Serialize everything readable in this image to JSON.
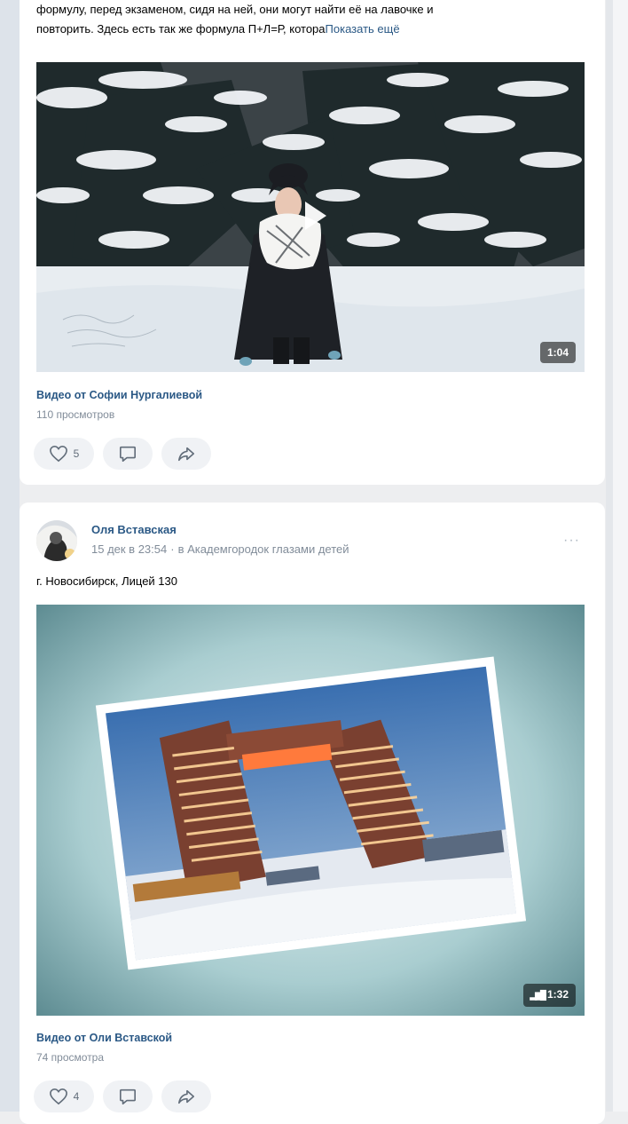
{
  "post1": {
    "text_line1": "формулу, перед экзаменом, сидя на ней, они могут найти её на лавочке и",
    "text_line2": "повторить. Здесь есть так же формула П+Л=Р, котора",
    "show_more": "Показать ещё",
    "video": {
      "duration": "1:04",
      "title": "Видео от Софии Нургалиевой",
      "views": "110 просмотров"
    },
    "likes": "5"
  },
  "post2": {
    "author": "Оля Вставская",
    "time": "15 дек в 23:54",
    "separator": "·",
    "community": "в Академгородок глазами детей",
    "more": "···",
    "text": "г. Новосибирск, Лицей 130",
    "video": {
      "duration": "1:32",
      "title": "Видео от Оли Вставской",
      "views": "74 просмотра"
    },
    "likes": "4"
  },
  "icons": {
    "like": "heart-icon",
    "comment": "comment-icon",
    "share": "share-arrow-icon",
    "play": "play-icon",
    "sound_bars": "audio-bars-icon"
  },
  "colors": {
    "link": "#2a5885",
    "muted": "#818c99",
    "background": "#edeef0",
    "card": "#ffffff",
    "action_bg": "#f0f2f5"
  }
}
